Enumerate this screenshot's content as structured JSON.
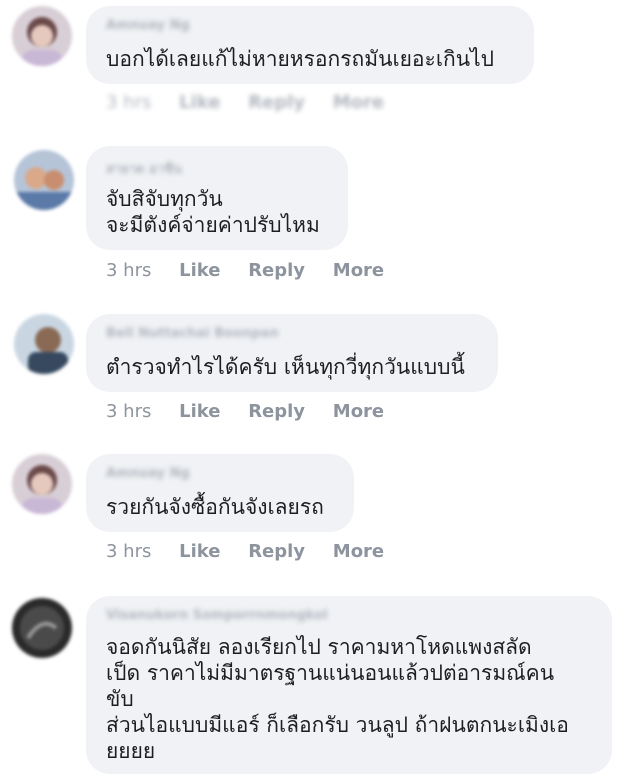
{
  "comments": [
    {
      "author": "Amnuay Ng",
      "lines": "บอกได้เลยแก้ไม่หายหรอกรถมันเยอะเกินไป",
      "time": "3 hrs",
      "like": "Like",
      "reply": "Reply",
      "more": "More"
    },
    {
      "author": "สายาด อาชีน",
      "lines": "จับสิจับทุกวัน\nจะมีตังค์จ่ายค่าปรับไหม",
      "time": "3 hrs",
      "like": "Like",
      "reply": "Reply",
      "more": "More"
    },
    {
      "author": "Bell Nuttachai Boonpan",
      "lines": "ตำรวจทำไรได้ครับ เห็นทุกวี่ทุกวันแบบนี้",
      "time": "3 hrs",
      "like": "Like",
      "reply": "Reply",
      "more": "More"
    },
    {
      "author": "Amnuay Ng",
      "lines": "รวยกันจังซื้อกันจังเลยรถ",
      "time": "3 hrs",
      "like": "Like",
      "reply": "Reply",
      "more": "More"
    },
    {
      "author": "Visanukorn Somporrnmongkol",
      "lines": "จอดกันนิสัย ลองเรียกไป ราคามหาโหดแพงสลัด\nเป็ด ราคาไม่มีมาตรฐานแน่นอนแล้วปต่อารมณ์คน\nขับ\nส่วนไอแบบมีแอร์ ก็เลือกรับ วนลูป ถ้าฝนตกนะเมิงเอ\nยยยย"
    }
  ],
  "colors": {
    "bubble": "#f0f2f5",
    "text": "#1c1e21",
    "meta": "#8d949e"
  }
}
